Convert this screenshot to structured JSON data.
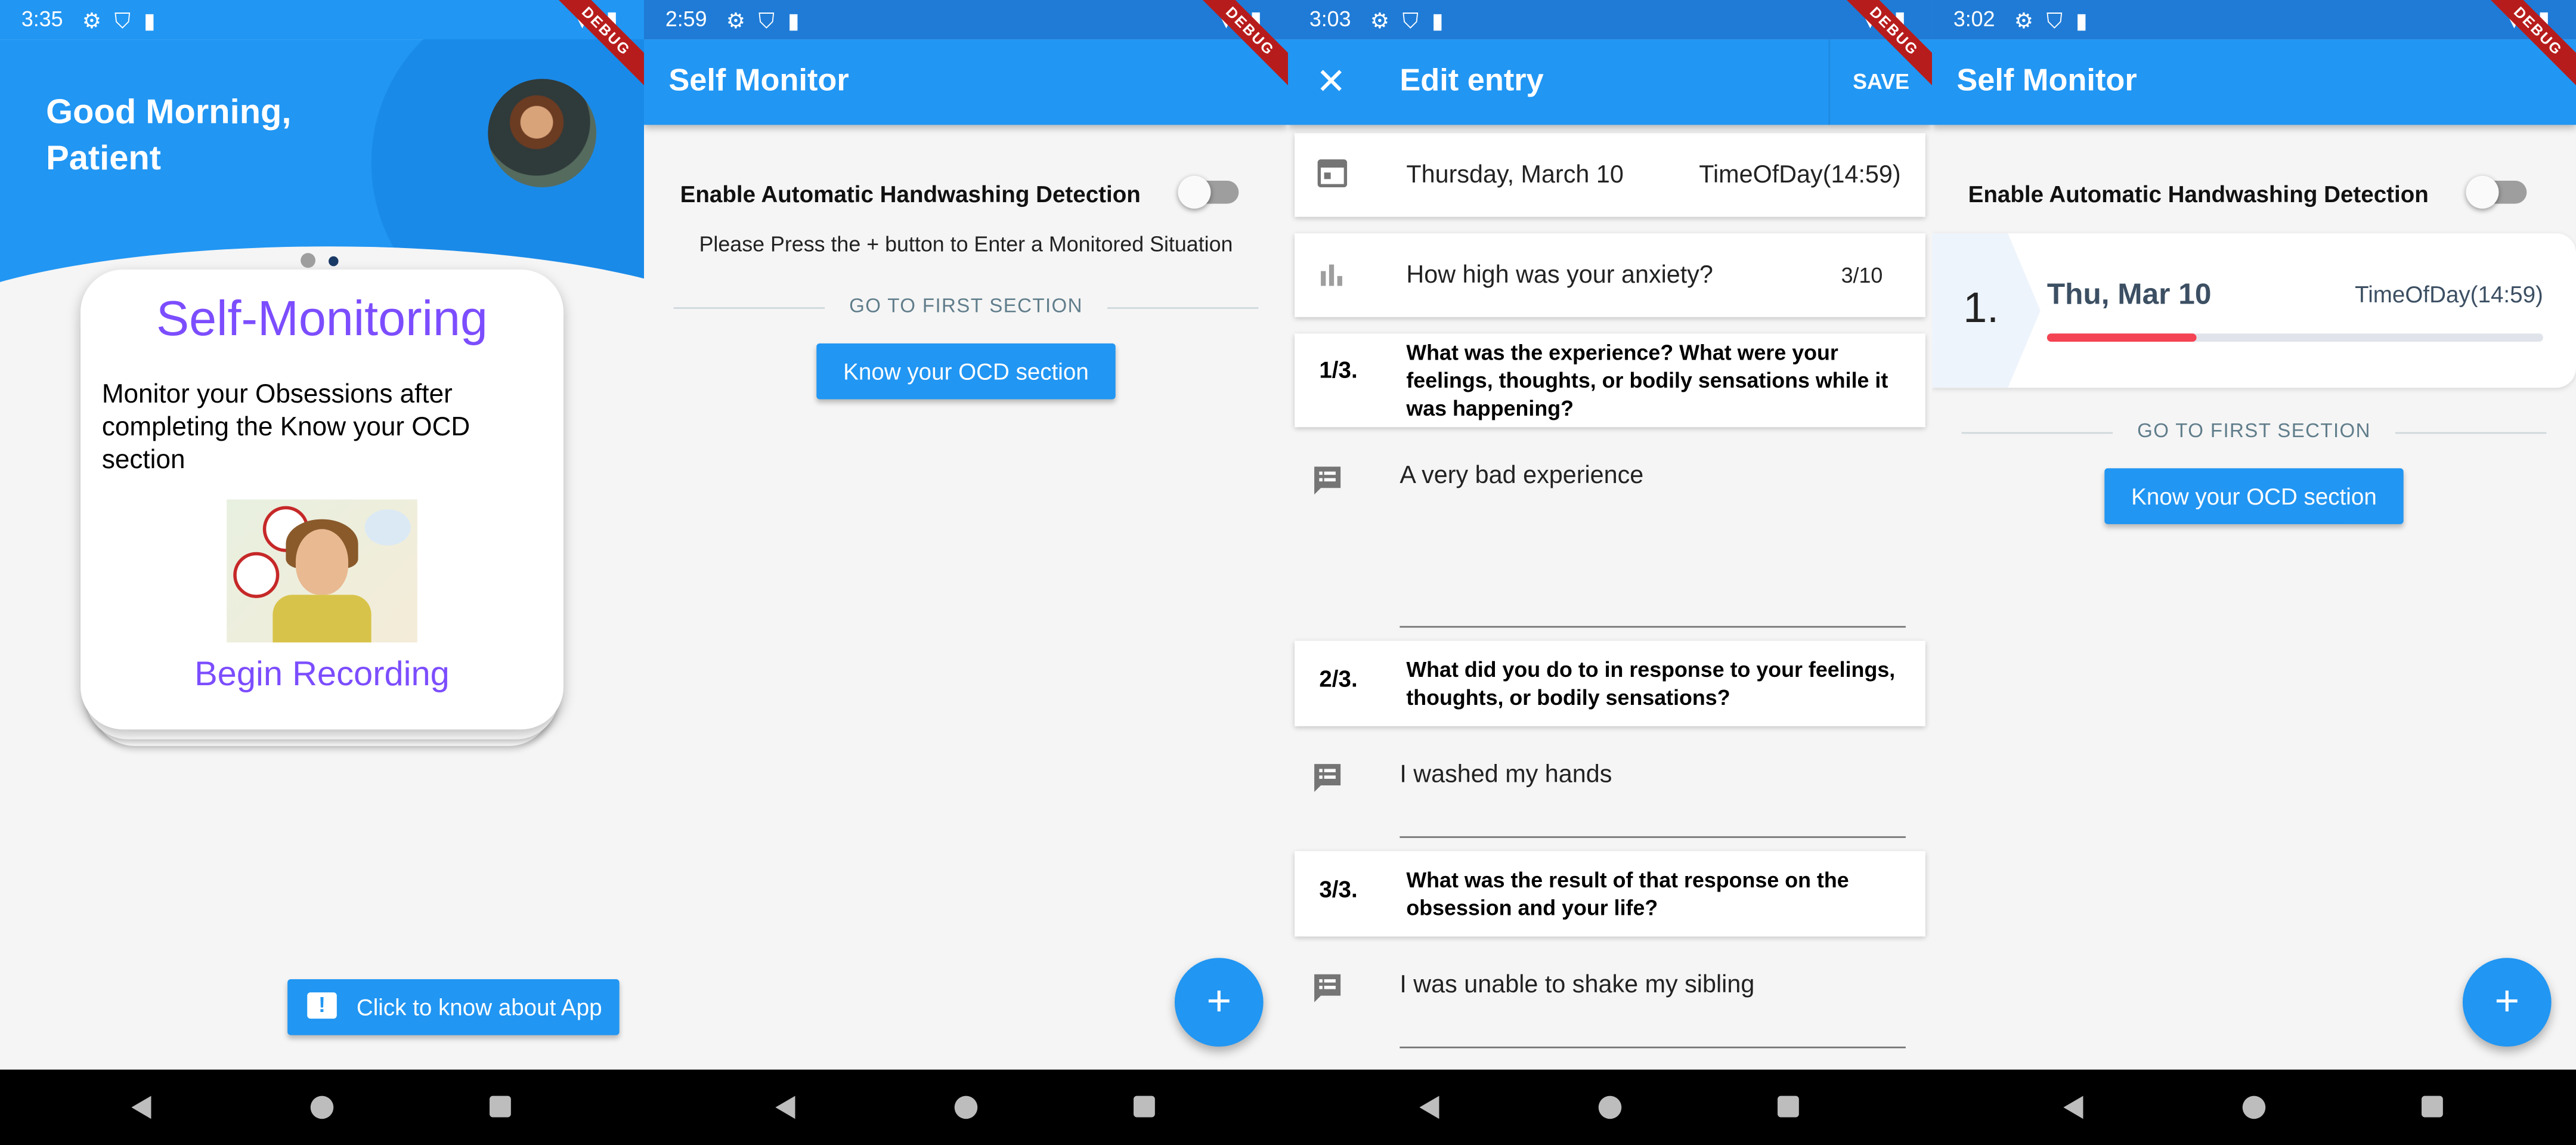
{
  "panels": [
    {
      "status_time": "3:35",
      "greeting": "Good Morning, Patient",
      "card": {
        "title": "Self-Monitoring",
        "body": "Monitor your Obsessions after completing the Know your OCD section",
        "action": "Begin Recording"
      },
      "about_button": "Click to know about App"
    },
    {
      "status_time": "2:59",
      "title": "Self Monitor",
      "toggle_label": "Enable Automatic Handwashing Detection",
      "hint": "Please Press the + button to Enter a Monitored Situation",
      "divider_label": "GO TO FIRST SECTION",
      "section_button": "Know your OCD section",
      "fab_label": "+"
    },
    {
      "status_time": "3:03",
      "title": "Edit entry",
      "close_label": "✕",
      "save_label": "SAVE",
      "date": "Thursday, March 10",
      "time": "TimeOfDay(14:59)",
      "anxiety_question": "How high was your anxiety?",
      "anxiety_value": "3/10",
      "questions": [
        {
          "num": "1/3.",
          "text": "What was the experience? What were your feelings, thoughts, or bodily sensations while it was happening?",
          "answer": "A very bad experience"
        },
        {
          "num": "2/3.",
          "text": "What did you do to in response to your feelings, thoughts, or bodily sensations?",
          "answer": "I washed my hands"
        },
        {
          "num": "3/3.",
          "text": "What was the result of that response on the obsession and your life?",
          "answer": "I was unable to shake my sibling"
        }
      ]
    },
    {
      "status_time": "3:02",
      "title": "Self Monitor",
      "toggle_label": "Enable Automatic Handwashing Detection",
      "entry": {
        "index": "1.",
        "date": "Thu, Mar 10",
        "time": "TimeOfDay(14:59)",
        "anxiety_fraction": 0.3
      },
      "divider_label": "GO TO FIRST SECTION",
      "section_button": "Know your OCD section",
      "fab_label": "+"
    }
  ],
  "debug_label": "DEBUG",
  "colors": {
    "primary": "#2196f3",
    "accent_purple": "#7c4dff",
    "progress_red": "#f44352",
    "debug_banner": "#b71c1c"
  }
}
